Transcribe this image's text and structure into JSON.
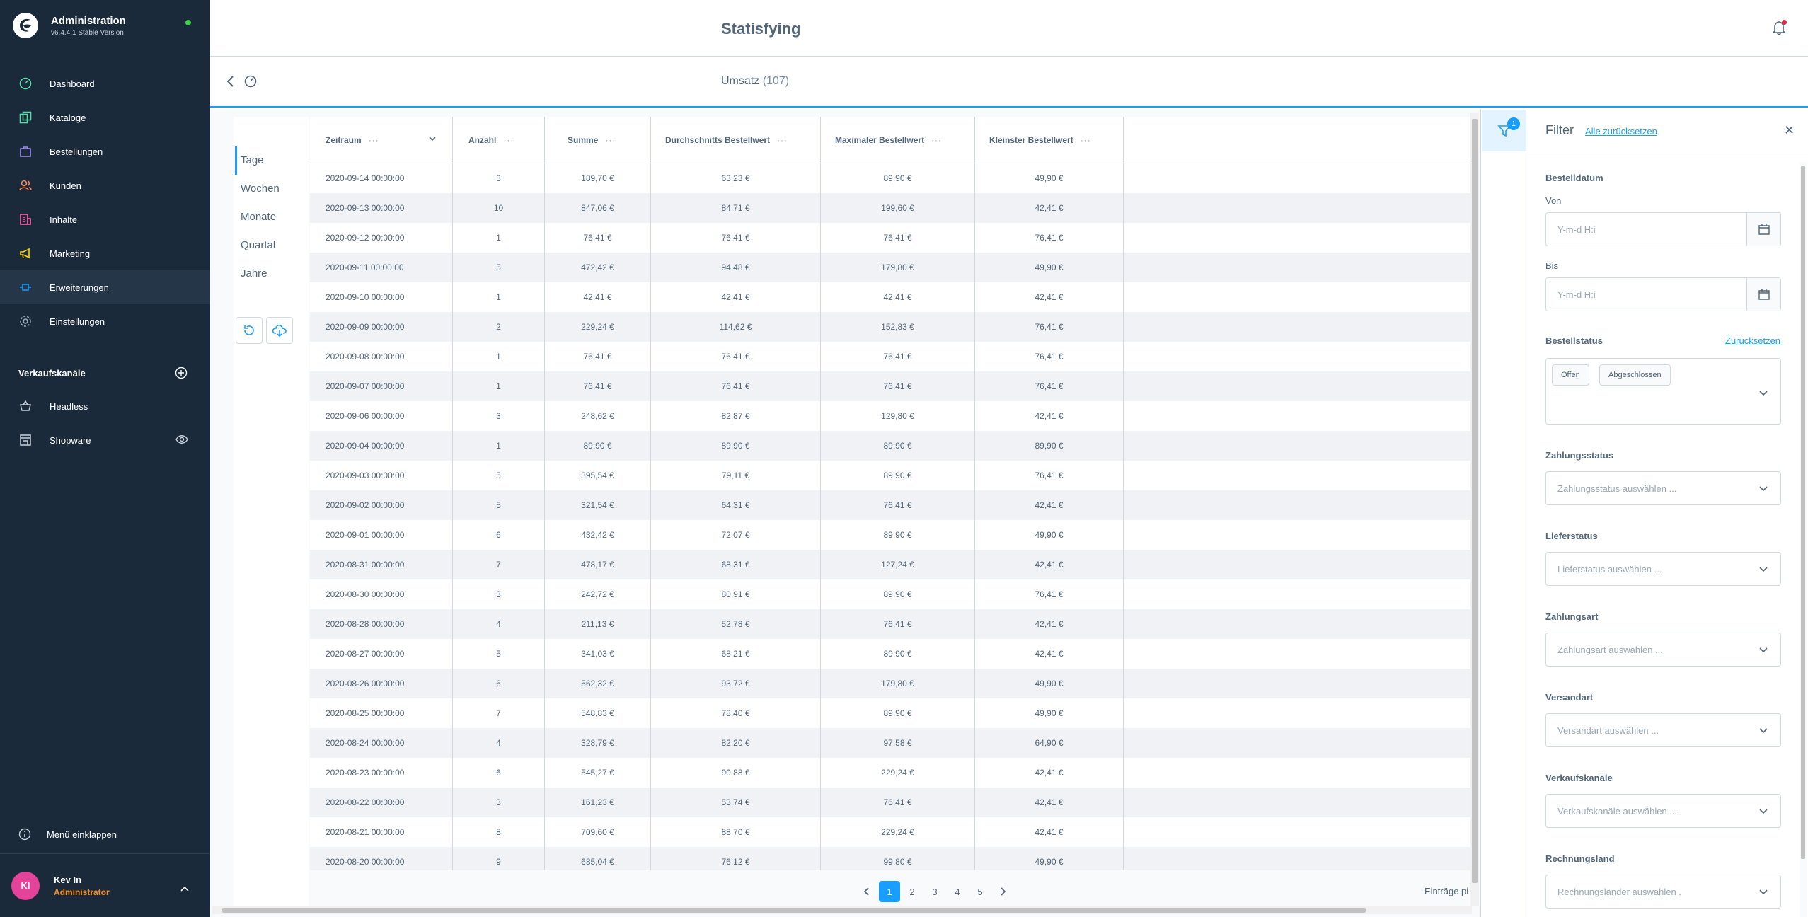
{
  "app": {
    "name": "Administration",
    "version": "v6.4.4.1 Stable Version"
  },
  "nav": [
    {
      "label": "Dashboard",
      "icon": "dashboard-icon",
      "color": "#57d9a3"
    },
    {
      "label": "Kataloge",
      "icon": "catalog-icon",
      "color": "#57d9a3"
    },
    {
      "label": "Bestellungen",
      "icon": "orders-icon",
      "color": "#a092f0"
    },
    {
      "label": "Kunden",
      "icon": "customers-icon",
      "color": "#f88962"
    },
    {
      "label": "Inhalte",
      "icon": "content-icon",
      "color": "#ff68b4"
    },
    {
      "label": "Marketing",
      "icon": "marketing-icon",
      "color": "#ffd700"
    },
    {
      "label": "Erweiterungen",
      "icon": "extensions-icon",
      "color": "#189eff"
    },
    {
      "label": "Einstellungen",
      "icon": "settings-icon",
      "color": "#9aa8b5"
    }
  ],
  "sales_channels": {
    "title": "Verkaufskanäle",
    "items": [
      {
        "label": "Headless"
      },
      {
        "label": "Shopware"
      }
    ]
  },
  "collapse_label": "Menü einklappen",
  "user": {
    "initials": "KI",
    "name": "Kev In",
    "role": "Administrator"
  },
  "header": {
    "title": "Statisfying"
  },
  "subheader": {
    "title": "Umsatz",
    "count": "(107)"
  },
  "ranges": [
    "Tage",
    "Wochen",
    "Monate",
    "Quartal",
    "Jahre"
  ],
  "grid": {
    "columns": [
      "Zeitraum",
      "Anzahl",
      "Summe",
      "Durchschnitts Bestellwert",
      "Maximaler Bestellwert",
      "Kleinster Bestellwert"
    ],
    "rows": [
      [
        "2020-09-14 00:00:00",
        "3",
        "189,70 €",
        "63,23 €",
        "89,90 €",
        "49,90 €"
      ],
      [
        "2020-09-13 00:00:00",
        "10",
        "847,06 €",
        "84,71 €",
        "199,60 €",
        "42,41 €"
      ],
      [
        "2020-09-12 00:00:00",
        "1",
        "76,41 €",
        "76,41 €",
        "76,41 €",
        "76,41 €"
      ],
      [
        "2020-09-11 00:00:00",
        "5",
        "472,42 €",
        "94,48 €",
        "179,80 €",
        "49,90 €"
      ],
      [
        "2020-09-10 00:00:00",
        "1",
        "42,41 €",
        "42,41 €",
        "42,41 €",
        "42,41 €"
      ],
      [
        "2020-09-09 00:00:00",
        "2",
        "229,24 €",
        "114,62 €",
        "152,83 €",
        "76,41 €"
      ],
      [
        "2020-09-08 00:00:00",
        "1",
        "76,41 €",
        "76,41 €",
        "76,41 €",
        "76,41 €"
      ],
      [
        "2020-09-07 00:00:00",
        "1",
        "76,41 €",
        "76,41 €",
        "76,41 €",
        "76,41 €"
      ],
      [
        "2020-09-06 00:00:00",
        "3",
        "248,62 €",
        "82,87 €",
        "129,80 €",
        "42,41 €"
      ],
      [
        "2020-09-04 00:00:00",
        "1",
        "89,90 €",
        "89,90 €",
        "89,90 €",
        "89,90 €"
      ],
      [
        "2020-09-03 00:00:00",
        "5",
        "395,54 €",
        "79,11 €",
        "89,90 €",
        "76,41 €"
      ],
      [
        "2020-09-02 00:00:00",
        "5",
        "321,54 €",
        "64,31 €",
        "76,41 €",
        "42,41 €"
      ],
      [
        "2020-09-01 00:00:00",
        "6",
        "432,42 €",
        "72,07 €",
        "89,90 €",
        "49,90 €"
      ],
      [
        "2020-08-31 00:00:00",
        "7",
        "478,17 €",
        "68,31 €",
        "127,24 €",
        "42,41 €"
      ],
      [
        "2020-08-30 00:00:00",
        "3",
        "242,72 €",
        "80,91 €",
        "89,90 €",
        "76,41 €"
      ],
      [
        "2020-08-28 00:00:00",
        "4",
        "211,13 €",
        "52,78 €",
        "76,41 €",
        "42,41 €"
      ],
      [
        "2020-08-27 00:00:00",
        "5",
        "341,03 €",
        "68,21 €",
        "89,90 €",
        "42,41 €"
      ],
      [
        "2020-08-26 00:00:00",
        "6",
        "562,32 €",
        "93,72 €",
        "179,80 €",
        "49,90 €"
      ],
      [
        "2020-08-25 00:00:00",
        "7",
        "548,83 €",
        "78,40 €",
        "89,90 €",
        "49,90 €"
      ],
      [
        "2020-08-24 00:00:00",
        "4",
        "328,79 €",
        "82,20 €",
        "97,58 €",
        "64,90 €"
      ],
      [
        "2020-08-23 00:00:00",
        "6",
        "545,27 €",
        "90,88 €",
        "229,24 €",
        "42,41 €"
      ],
      [
        "2020-08-22 00:00:00",
        "3",
        "161,23 €",
        "53,74 €",
        "76,41 €",
        "42,41 €"
      ],
      [
        "2020-08-21 00:00:00",
        "8",
        "709,60 €",
        "88,70 €",
        "229,24 €",
        "42,41 €"
      ],
      [
        "2020-08-20 00:00:00",
        "9",
        "685,04 €",
        "76,12 €",
        "99,80 €",
        "49,90 €"
      ]
    ]
  },
  "pagination": {
    "pages": [
      "1",
      "2",
      "3",
      "4",
      "5"
    ],
    "current": "1",
    "entries_label": "Einträge pi"
  },
  "filter": {
    "badge": "1",
    "title": "Filter",
    "reset_all": "Alle zurücksetzen",
    "order_date": {
      "label": "Bestelldatum",
      "from_label": "Von",
      "to_label": "Bis",
      "placeholder": "Y-m-d H:i"
    },
    "order_status": {
      "label": "Bestellstatus",
      "reset": "Zurücksetzen",
      "chips": [
        "Offen",
        "Abgeschlossen"
      ]
    },
    "payment_status": {
      "label": "Zahlungsstatus",
      "placeholder": "Zahlungsstatus auswählen ..."
    },
    "delivery_status": {
      "label": "Lieferstatus",
      "placeholder": "Lieferstatus auswählen ..."
    },
    "payment_method": {
      "label": "Zahlungsart",
      "placeholder": "Zahlungsart auswählen ..."
    },
    "shipping_method": {
      "label": "Versandart",
      "placeholder": "Versandart auswählen ..."
    },
    "sales_channels": {
      "label": "Verkaufskanäle",
      "placeholder": "Verkaufskanäle auswählen ..."
    },
    "billing_country": {
      "label": "Rechnungsland",
      "placeholder": "Rechnungsländer auswählen ."
    }
  }
}
